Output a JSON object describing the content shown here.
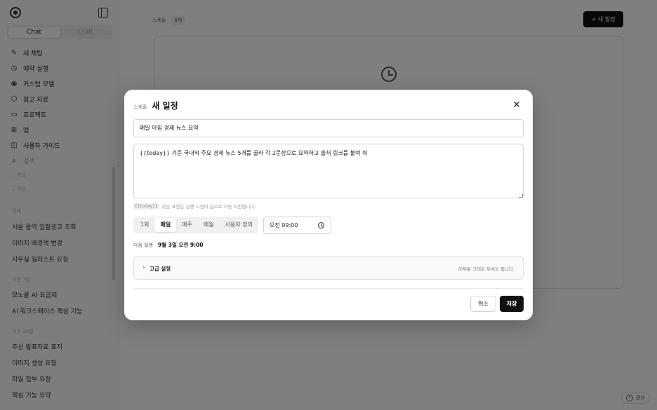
{
  "sidebar": {
    "tabs": [
      "Chat",
      "Craft"
    ],
    "menu": [
      {
        "label": "새 채팅",
        "icon": "edit-icon"
      },
      {
        "label": "예약 실행",
        "icon": "clock-icon"
      },
      {
        "label": "커스텀 모델",
        "icon": "model-icon"
      },
      {
        "label": "참고 자료",
        "icon": "cube-icon"
      },
      {
        "label": "프로젝트",
        "icon": "folder-icon"
      },
      {
        "label": "앱",
        "icon": "apps-icon"
      },
      {
        "label": "사용자 가이드",
        "icon": "book-icon"
      },
      {
        "label": "검색",
        "icon": "search-icon"
      }
    ],
    "collapsed": [
      "채널",
      "채팅"
    ],
    "sections": [
      {
        "title": "어제",
        "items": [
          "서울 용역 입찰공고 조회",
          "이미지 배경색 변경",
          "사무실 일러스트 요청"
        ]
      },
      {
        "title": "이전 7일",
        "items": [
          "모노클 AI 요금제",
          "AI 워크스페이스 핵심 기능"
        ]
      },
      {
        "title": "이전 30일",
        "items": [
          "추상 발표자료 표지",
          "이미지 생성 요청",
          "파일 첨부 요청",
          "핵심 기능 요약"
        ]
      }
    ]
  },
  "main": {
    "label": "스케줄",
    "count": "0개",
    "new_button": "+ 새 일정",
    "help": "문의"
  },
  "modal": {
    "crumb": "스케줄",
    "title": "새 일정",
    "name_value": "매일 아침 경제 뉴스 요약",
    "prompt_value": "{{today}} 기준 국내외 주요 경제 뉴스 5개를 골라 각 2문장으로 요약하고 출처 링크를 붙여 줘",
    "hint_code": "{{today}}",
    "hint_text": "같은 표현은 실행 시점의 값으로 자동 치환됩니다.",
    "frequency_options": [
      "1회",
      "매일",
      "매주",
      "매월",
      "사용자 정의"
    ],
    "frequency_selected": "매일",
    "time_value": "오전 09:00",
    "next_run_label": "다음 실행",
    "next_run_value": "9월 3일 오전 9:00",
    "advanced_label": "고급 설정",
    "advanced_hint": "대부분 그대로 두셔도 됩니다.",
    "cancel_label": "취소",
    "save_label": "저장"
  }
}
